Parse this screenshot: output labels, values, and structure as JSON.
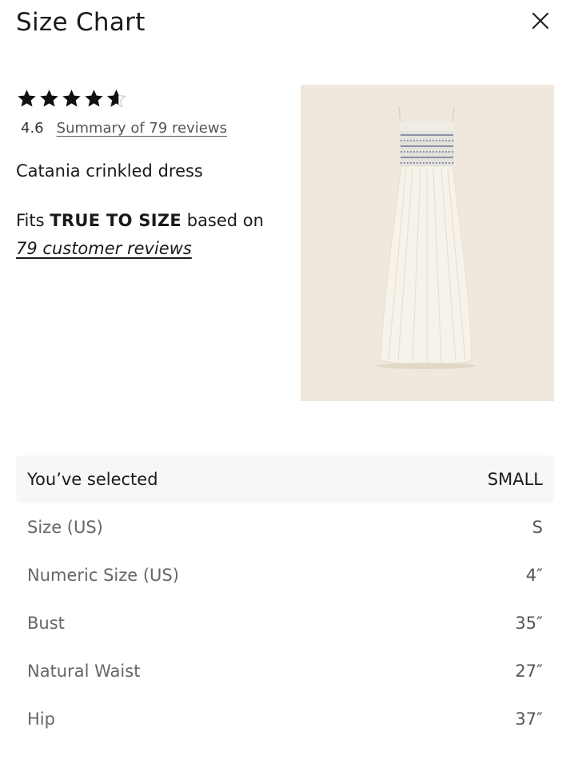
{
  "header": {
    "title": "Size Chart",
    "close_icon": "close-icon"
  },
  "rating": {
    "stars": 4.6,
    "value": "4.6",
    "summary_link": "Summary of 79 reviews"
  },
  "product": {
    "name": "Catania crinkled dress"
  },
  "fit": {
    "prefix": "Fits ",
    "emphasis": "TRUE TO SIZE",
    "suffix": " based on",
    "reviews_link": "79 customer reviews"
  },
  "size_table": {
    "selected": {
      "label": "You’ve selected",
      "value": "SMALL"
    },
    "rows": [
      {
        "label": "Size (US)",
        "value": "S"
      },
      {
        "label": "Numeric Size (US)",
        "value": "4″"
      },
      {
        "label": "Bust",
        "value": "35″"
      },
      {
        "label": "Natural Waist",
        "value": "27″"
      },
      {
        "label": "Hip",
        "value": "37″"
      }
    ]
  },
  "colors": {
    "image_background": "#f0e8dc",
    "selected_row_bg": "#f7f7f8"
  }
}
